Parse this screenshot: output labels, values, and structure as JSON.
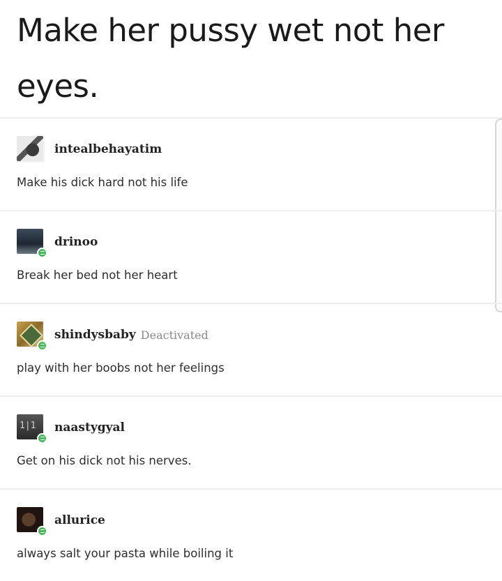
{
  "post": {
    "headline": "Make her pussy wet not her eyes."
  },
  "replies": [
    {
      "username": "intealbehayatim",
      "status": "",
      "text": "Make his dick hard not his life",
      "avatar_icon": "user-avatar",
      "badge": false
    },
    {
      "username": "drinoo",
      "status": "",
      "text": "Break her bed not her heart",
      "avatar_icon": "user-avatar",
      "badge": true
    },
    {
      "username": "shindysbaby",
      "status": "Deactivated",
      "text": "play with her boobs not her feelings",
      "avatar_icon": "user-avatar",
      "badge": true
    },
    {
      "username": "naastygyal",
      "status": "",
      "text": "Get on his dick not his nerves.",
      "avatar_icon": "user-avatar",
      "badge": true
    },
    {
      "username": "allurice",
      "status": "",
      "text": "always salt your pasta while boiling it",
      "avatar_icon": "user-avatar",
      "badge": true
    }
  ],
  "colors": {
    "badge": "#46b85a",
    "divider": "#eeeeee",
    "muted_text": "#8a8a8a"
  }
}
